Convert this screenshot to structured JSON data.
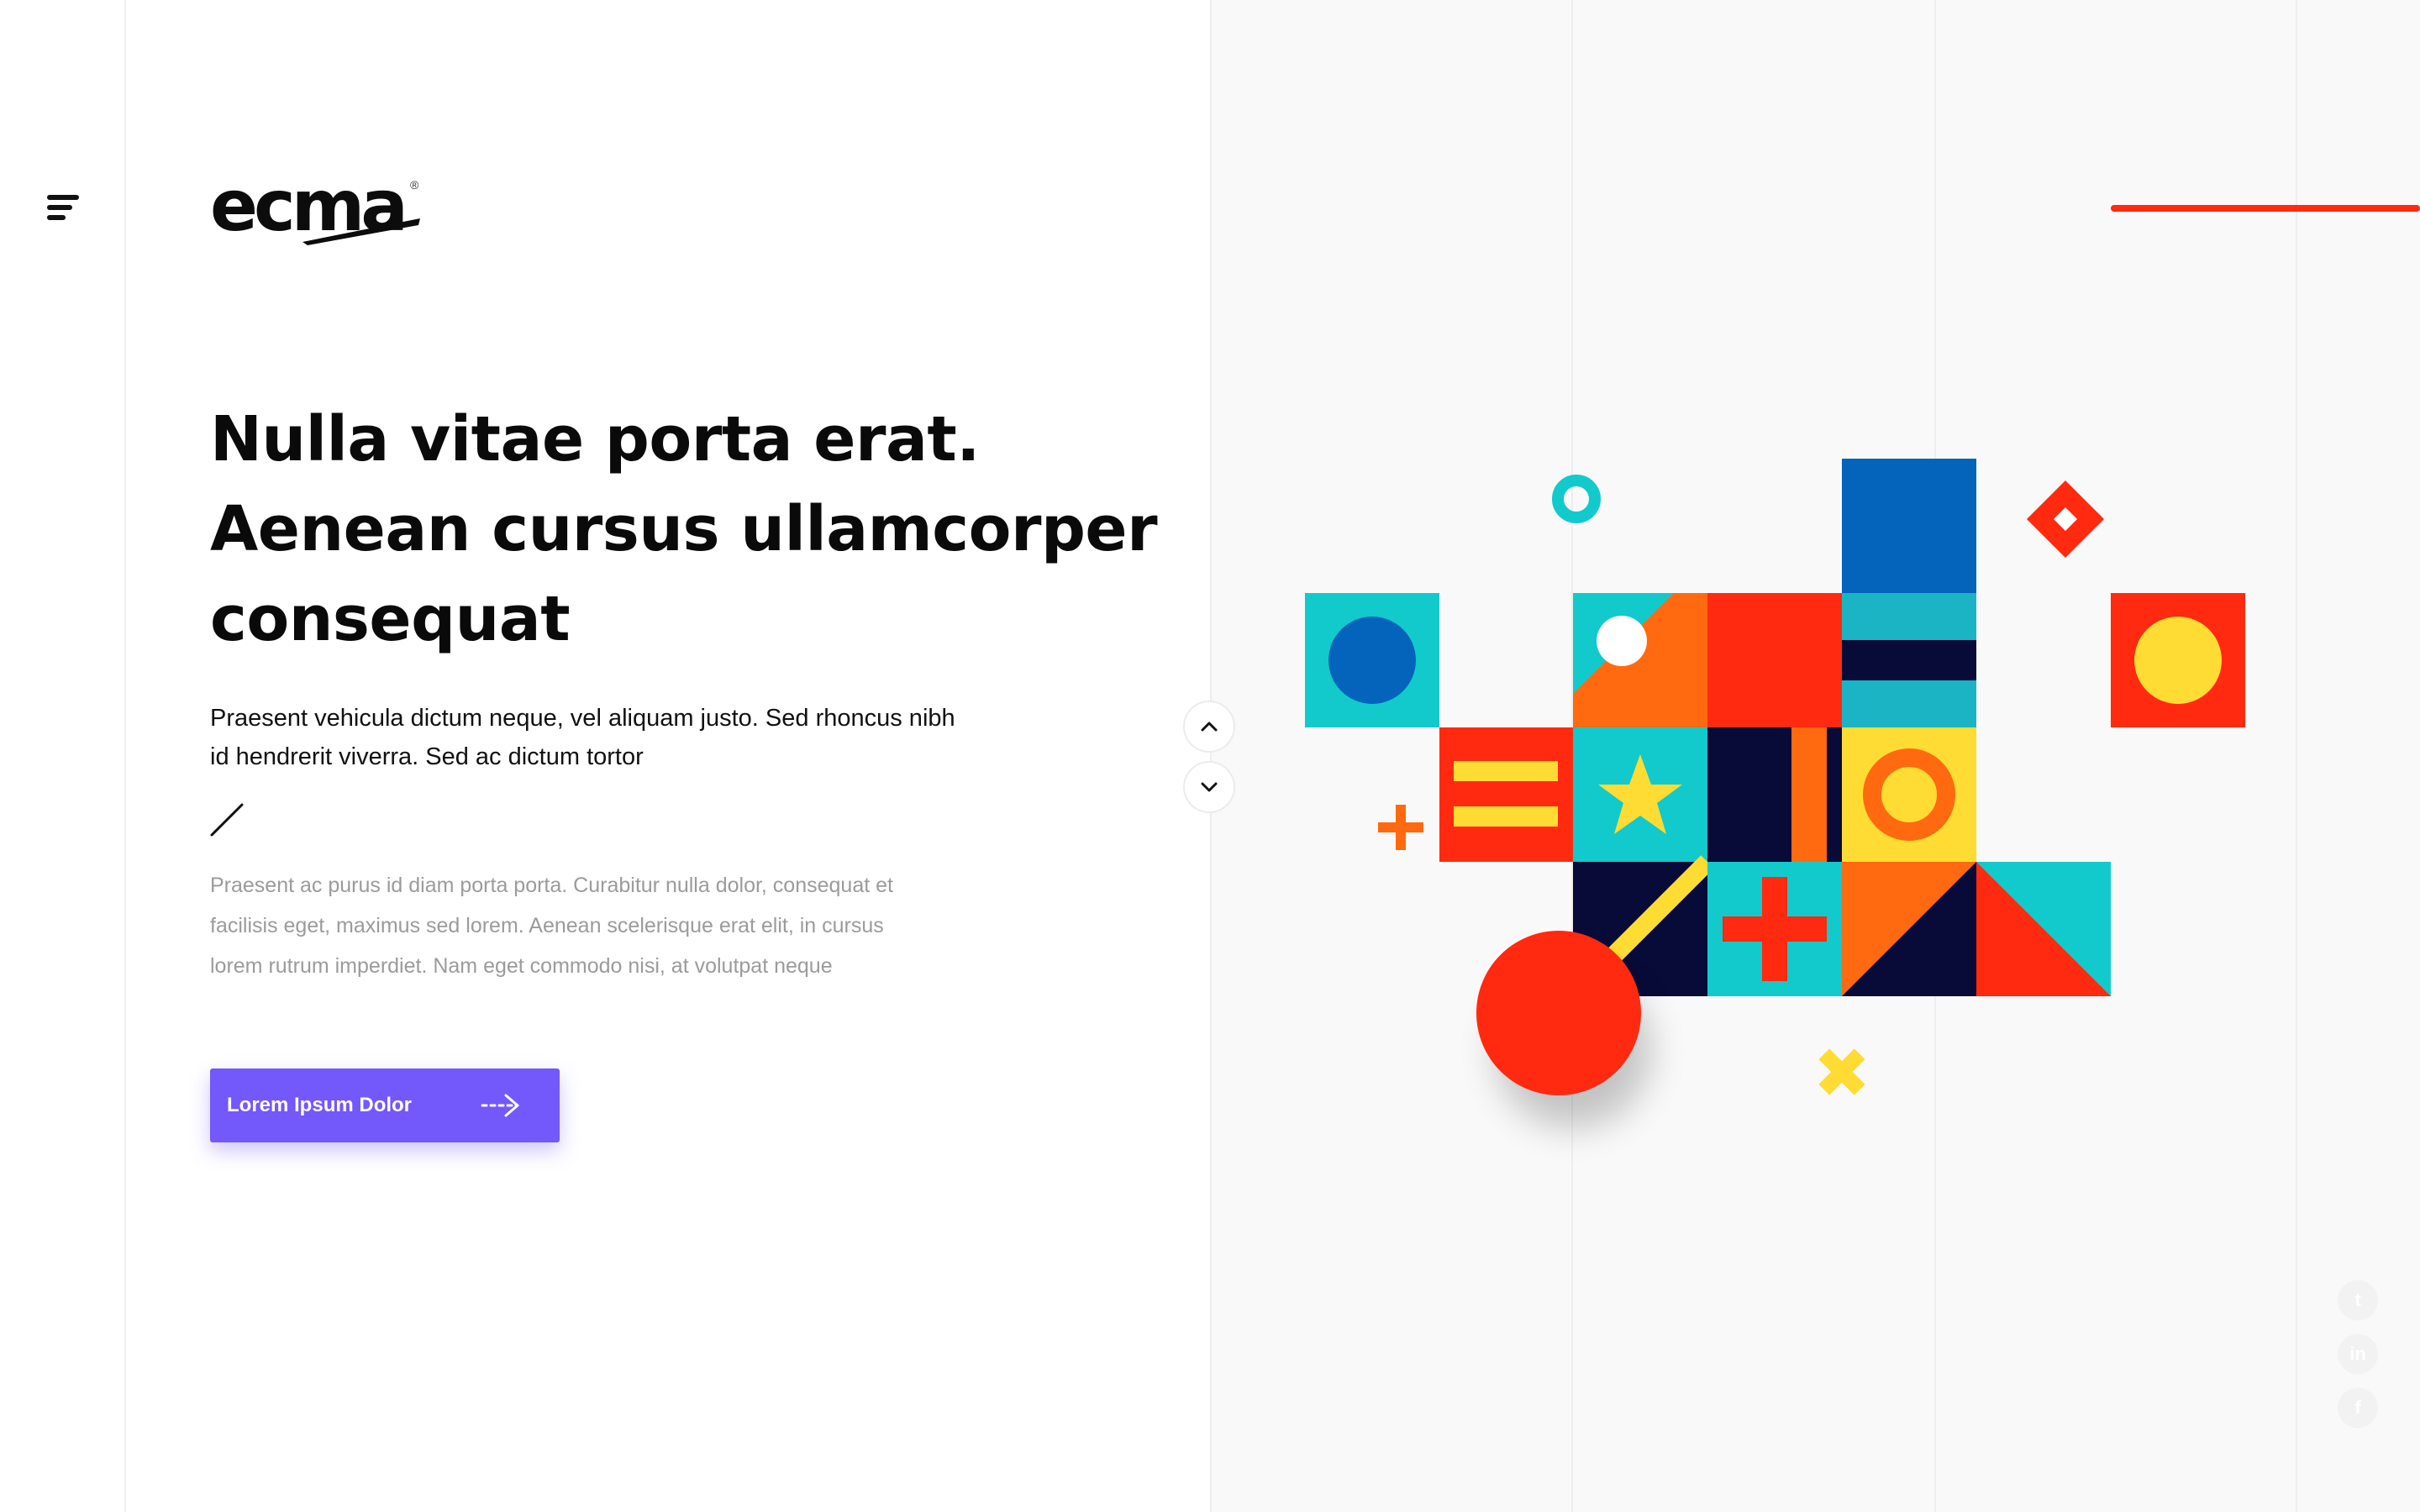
{
  "brand": {
    "logo_text": "ecma",
    "logo_mark": "®"
  },
  "hero": {
    "headline": "Nulla vitae porta erat. Aenean cursus ullamcorper consequat",
    "lead": "Praesent vehicula dictum neque, vel aliquam justo. Sed rhoncus nibh id hendrerit viverra. Sed ac dictum tortor",
    "body": "Praesent ac purus id diam porta porta. Curabitur nulla dolor, consequat et facilisis eget, maximus sed lorem. Aenean scelerisque erat elit, in cursus lorem rutrum imperdiet. Nam eget commodo nisi, at volutpat neque"
  },
  "cta": {
    "label": "Lorem Ipsum Dolor",
    "icon": "arrow-right-icon"
  },
  "nav": {
    "menu_icon": "hamburger-menu-icon",
    "scroll_up_icon": "chevron-up-icon",
    "scroll_down_icon": "chevron-down-icon"
  },
  "social": {
    "twitter": "t",
    "linkedin": "in",
    "facebook": "f"
  },
  "colors": {
    "accent": "#7358fb",
    "red": "#ff2a10",
    "cyan": "#12cacb",
    "blue": "#0464bc",
    "navy": "#080a38",
    "orange": "#ff6a10",
    "yellow": "#ffdc33"
  }
}
